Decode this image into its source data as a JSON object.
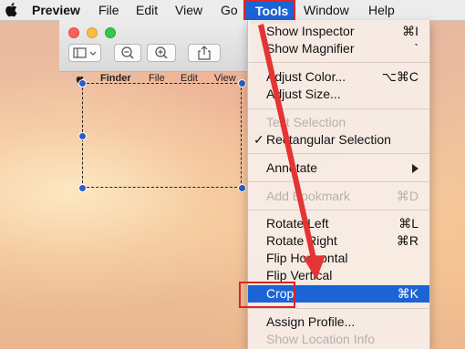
{
  "menubar": {
    "app_name": "Preview",
    "items": [
      "File",
      "Edit",
      "View",
      "Go",
      "Tools",
      "Window",
      "Help"
    ]
  },
  "window": {
    "finder_strip": [
      "Finder",
      "File",
      "Edit",
      "View"
    ]
  },
  "tools_menu": {
    "items": [
      {
        "label": "Show Inspector",
        "shortcut": "⌘I"
      },
      {
        "label": "Show Magnifier",
        "shortcut": "`"
      },
      {
        "label": "Adjust Color...",
        "shortcut": "⌥⌘C"
      },
      {
        "label": "Adjust Size...",
        "shortcut": ""
      },
      {
        "label": "Text Selection",
        "shortcut": ""
      },
      {
        "label": "Rectangular Selection",
        "shortcut": ""
      },
      {
        "label": "Annotate",
        "shortcut": ""
      },
      {
        "label": "Add Bookmark",
        "shortcut": "⌘D"
      },
      {
        "label": "Rotate Left",
        "shortcut": "⌘L"
      },
      {
        "label": "Rotate Right",
        "shortcut": "⌘R"
      },
      {
        "label": "Flip Horizontal",
        "shortcut": ""
      },
      {
        "label": "Flip Vertical",
        "shortcut": ""
      },
      {
        "label": "Crop",
        "shortcut": "⌘K"
      },
      {
        "label": "Assign Profile...",
        "shortcut": ""
      },
      {
        "label": "Show Location Info",
        "shortcut": ""
      }
    ],
    "checkmark": "✓"
  },
  "colors": {
    "highlight": "#1c63d6",
    "annotation_red": "#e02424",
    "close": "#fc605c",
    "minimize": "#fdbc40",
    "zoom": "#34c84a"
  }
}
